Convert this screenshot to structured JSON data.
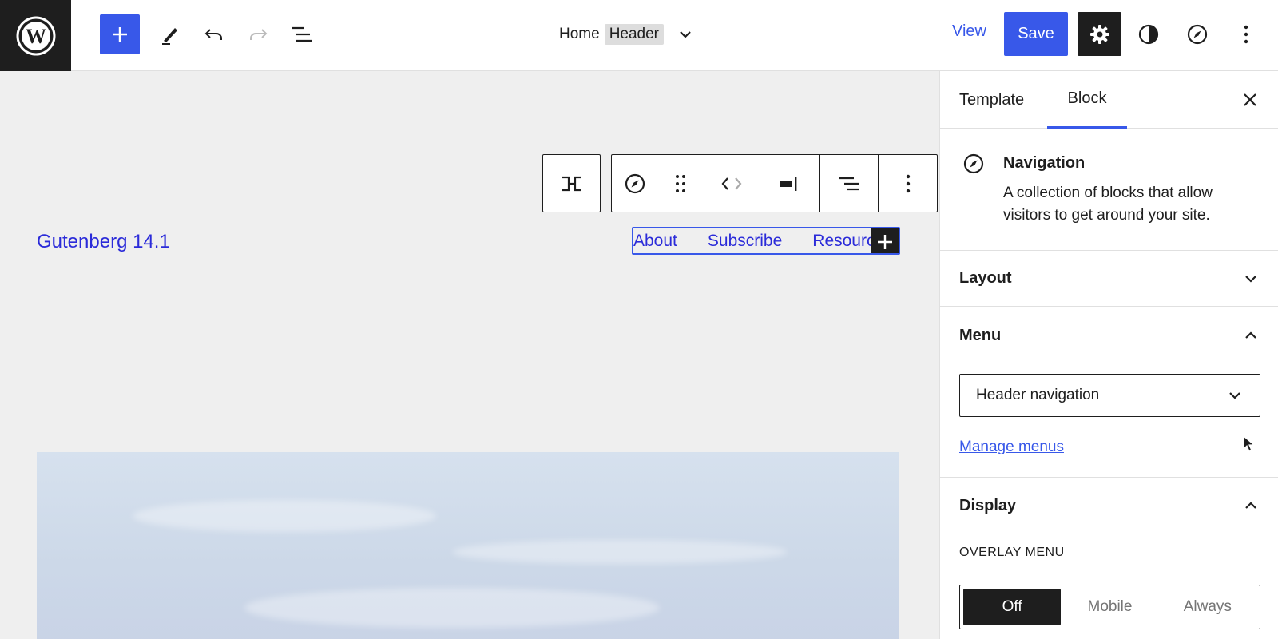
{
  "topbar": {
    "title": "Home",
    "template_part": "Header",
    "view_label": "View",
    "save_label": "Save"
  },
  "canvas": {
    "site_title": "Gutenberg 14.1",
    "nav_items": [
      "About",
      "Subscribe",
      "Resources"
    ]
  },
  "sidebar": {
    "tabs": {
      "template": "Template",
      "block": "Block"
    },
    "block_card": {
      "title": "Navigation",
      "description": "A collection of blocks that allow visitors to get around your site."
    },
    "layout_label": "Layout",
    "menu_label": "Menu",
    "menu_select_value": "Header navigation",
    "manage_menus": "Manage menus",
    "display_label": "Display",
    "overlay_menu_label": "OVERLAY MENU",
    "overlay_options": [
      "Off",
      "Mobile",
      "Always"
    ]
  },
  "colors": {
    "accent": "#3858e9",
    "dark": "#1e1e1e",
    "canvas_bg": "#efefef",
    "link": "#2b2bd9"
  }
}
